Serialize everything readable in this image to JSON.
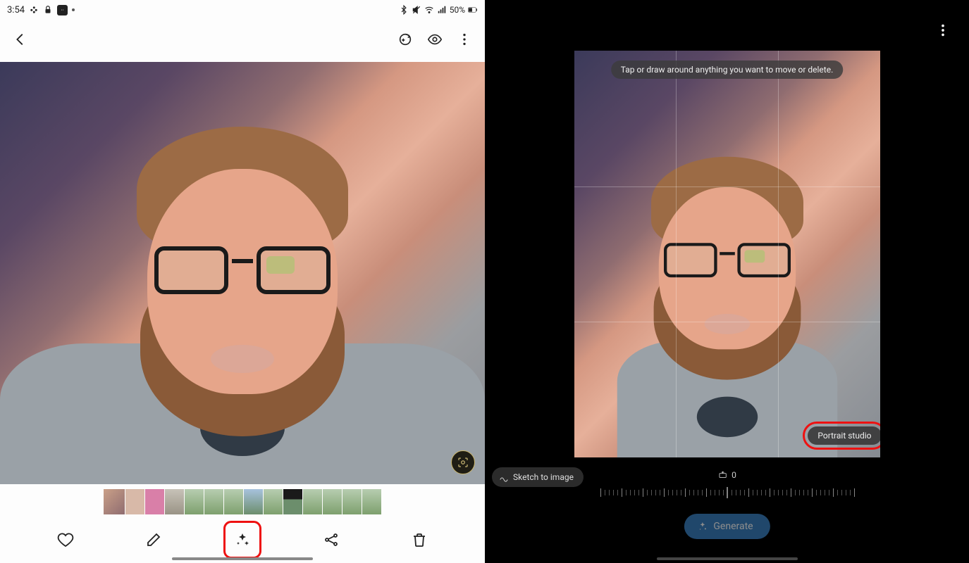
{
  "status_bar": {
    "time": "3:54",
    "battery_pct": "50%"
  },
  "editor": {
    "hint": "Tap or draw around anything you want to move or delete.",
    "portrait_studio_label": "Portrait studio",
    "sketch_label": "Sketch to image",
    "rotation_value": "0",
    "generate_label": "Generate"
  }
}
